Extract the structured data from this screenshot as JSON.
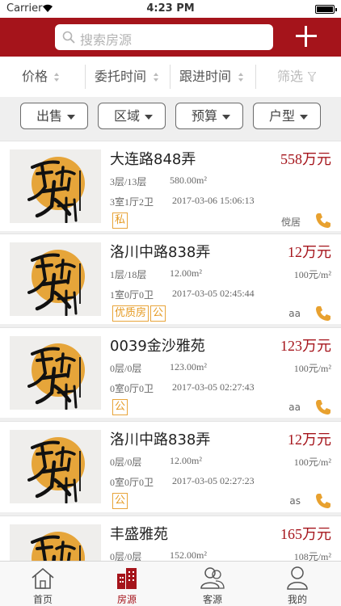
{
  "status": {
    "carrier": "Carrier",
    "time": "4:23 PM"
  },
  "search": {
    "placeholder": "搜索房源"
  },
  "sort": {
    "price": "价格",
    "entrust_time": "委托时间",
    "follow_time": "跟进时间",
    "filter": "筛选"
  },
  "categories": {
    "sale": "出售",
    "area": "区域",
    "budget": "预算",
    "house_type": "户型"
  },
  "listings": [
    {
      "title": "大连路848弄",
      "price": "558万元",
      "floor": "3层/13层",
      "area": "580.00m²",
      "layout": "3室1厅2卫",
      "date": "2017-03-06 15:06:13",
      "tags": [
        "私"
      ],
      "agent": "傥居",
      "unit_price": ""
    },
    {
      "title": "洛川中路838弄",
      "price": "12万元",
      "floor": "1层/18层",
      "area": "12.00m²",
      "layout": "1室0厅0卫",
      "date": "2017-03-05 02:45:44",
      "tags": [
        "优质房",
        "公"
      ],
      "agent": "aa",
      "unit_price": "100元/m²"
    },
    {
      "title": "0039金沙雅苑",
      "price": "123万元",
      "floor": "0层/0层",
      "area": "123.00m²",
      "layout": "0室0厅0卫",
      "date": "2017-03-05 02:27:43",
      "tags": [
        "公"
      ],
      "agent": "aa",
      "unit_price": "100元/m²"
    },
    {
      "title": "洛川中路838弄",
      "price": "12万元",
      "floor": "0层/0层",
      "area": "12.00m²",
      "layout": "0室0厅0卫",
      "date": "2017-03-05 02:27:23",
      "tags": [
        "公"
      ],
      "agent": "as",
      "unit_price": "100元/m²"
    },
    {
      "title": "丰盛雅苑",
      "price": "165万元",
      "floor": "0层/0层",
      "area": "152.00m²",
      "layout": "",
      "date": "",
      "tags": [],
      "agent": "",
      "unit_price": "108元/m²"
    }
  ],
  "tabs": {
    "home": "首页",
    "listings": "房源",
    "clients": "客源",
    "mine": "我的"
  },
  "colors": {
    "brand": "#a5141b",
    "tag": "#e59a22",
    "phone": "#e8a12f"
  }
}
